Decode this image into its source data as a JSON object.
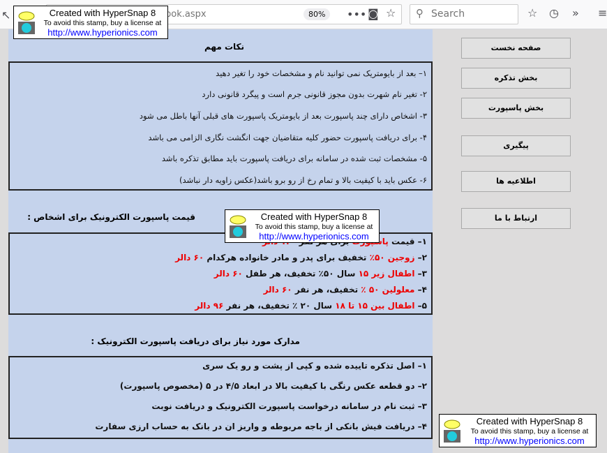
{
  "browser": {
    "url": "pok.aspx",
    "zoom": "80%",
    "search_placeholder": "Search"
  },
  "section1": {
    "title": "نکات مهم",
    "items": [
      "۱–   بعد از بایومتریک نمی توانید نام و مشخصات خود را تغیر دهید",
      "۲- تغیر نام شهرت بدون مجوز قانونی جرم است و پیگرد قانونی دارد",
      " ۳- اشخاص دارای چند پاسپورت بعد از بایومتریک پاسپورت های قبلی آنها باطل می شود",
      "۴- برای دریافت پاسپورت حضور کلیه متقاضیان جهت انگشت نگاری الزامی می باشد",
      "۵- مشخصات ثبت شده در سامانه برای دریافت پاسپورت باید مطابق تذکره باشد",
      "۶- عکس باید با کیفیت بالا و تمام رخ از رو برو باشد(عکس زاویه دار نباشد)"
    ]
  },
  "section2": {
    "title": "قیمت پاسپورت الکترونیک برای اشخاص :",
    "items": [
      [
        {
          "t": "۱– قیمت ",
          "r": false
        },
        {
          "t": "پاسپورت",
          "r": true
        },
        {
          "t": " برای هر نفر ",
          "r": false
        },
        {
          "t": "۱۲۰ دالر",
          "r": true
        }
      ],
      [
        {
          "t": "۲–  ",
          "r": false
        },
        {
          "t": "زوجین ۵۰٪",
          "r": true
        },
        {
          "t": " تخفیف برای پدر و مادر خانواده هرکدام  ",
          "r": false
        },
        {
          "t": "۶۰ دالر",
          "r": true
        }
      ],
      [
        {
          "t": "۳– ",
          "r": false
        },
        {
          "t": "اطفال زیر ۱۵",
          "r": true
        },
        {
          "t": " سال ۵۰٪ تخفیف، هر طفل  ",
          "r": false
        },
        {
          "t": "۶۰ دالر",
          "r": true
        }
      ],
      [
        {
          "t": "۴– ",
          "r": false
        },
        {
          "t": "معلولین ۵۰ ٪",
          "r": true
        },
        {
          "t": " تخفیف، هر نفر ",
          "r": false
        },
        {
          "t": "۶۰ دالر",
          "r": true
        }
      ],
      [
        {
          "t": "۵– ",
          "r": false
        },
        {
          "t": "اطفال بین ۱۵ تا ۱۸",
          "r": true
        },
        {
          "t": " سال ۲۰ ٪ تخفیف، هر نفر  ",
          "r": false
        },
        {
          "t": "۹۶ دالر",
          "r": true
        }
      ]
    ]
  },
  "section3": {
    "title": "مدارک مورد نیاز برای دریافت پاسپورت الکترونیک :",
    "items": [
      " ۱– اصل تذکره  تاییده شده و کپی از پشت و رو یک سری",
      "۲– دو قطعه عکس رنگی با کیفیت بالا در ابعاد ۴/۵ در ۵ (مخصوص پاسپورت)",
      "۳– ثبت نام در سامانه درخواست پاسپورت الکترونیک و دریافت نوبت",
      "۴– دریافت فیش بانکی  از باجه مربوطه و واریز  ان در بانک به حساب ارزی سفارت"
    ]
  },
  "nav": [
    "صفحه نخست",
    "بخش تذکره",
    "بخش پاسپورت",
    "پیگیری",
    "اطلاعیه ها",
    "ارتباط با ما"
  ],
  "stamp": {
    "line1": "Created with HyperSnap 8",
    "line2": "To avoid this stamp, buy a license at",
    "line3": "http://www.hyperionics.com"
  },
  "colors": {
    "panel": "#c5d3ec",
    "highlight": "#ee0000"
  }
}
